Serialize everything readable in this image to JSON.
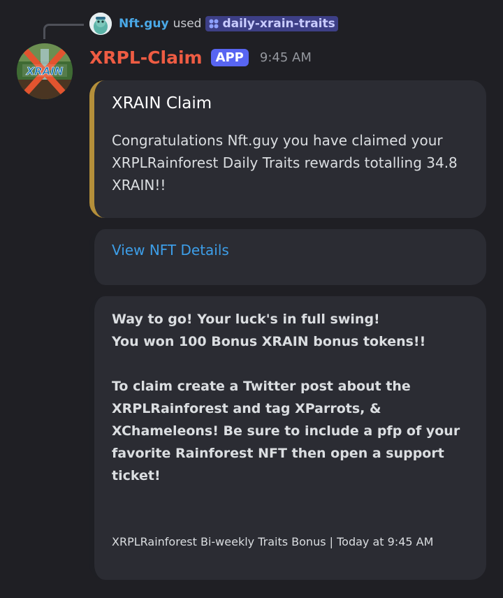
{
  "reply": {
    "user": "Nft.guy",
    "verb": "used",
    "command": "daily-xrain-traits"
  },
  "message": {
    "bot_name": "XRPL-Claim",
    "badge": "APP",
    "time": "9:45 AM",
    "avatar_label": "XRAIN"
  },
  "embeds": {
    "claim": {
      "title": "XRAIN Claim",
      "description": "Congratulations Nft.guy you have claimed your XRPLRainforest Daily Traits rewards totalling 34.8 XRAIN!!",
      "accent_color": "#b48f3a"
    },
    "details": {
      "link_label": "View NFT Details"
    },
    "bonus": {
      "line1": "Way to go! Your luck's in full swing!",
      "line2": "You won 100 Bonus XRAIN bonus tokens!!",
      "instructions": "To claim create a Twitter post about the XRPLRainforest and tag XParrots, & XChameleons! Be sure to include a pfp of your favorite Rainforest NFT then open a support ticket!",
      "footer": "XRPLRainforest Bi-weekly Traits Bonus | Today at 9:45 AM"
    }
  },
  "colors": {
    "background": "#1f1f24",
    "embed_bg": "#2b2c33",
    "bot_name": "#ee5c43",
    "app_badge": "#5865f2",
    "link": "#3d9ee8",
    "username": "#4aa8e6"
  }
}
